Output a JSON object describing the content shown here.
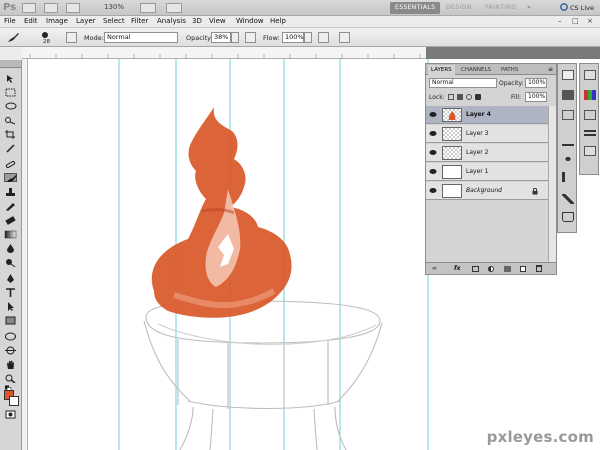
{
  "app": {
    "logo": "Ps",
    "zoom": "130%",
    "workspaces": [
      "ESSENTIALS",
      "DESIGN",
      "PAINTING"
    ],
    "workspace_more": "»",
    "cslive": "CS Live"
  },
  "menu": [
    "File",
    "Edit",
    "Image",
    "Layer",
    "Select",
    "Filter",
    "Analysis",
    "3D",
    "View",
    "Window",
    "Help"
  ],
  "window_controls": [
    "–",
    "□",
    "×"
  ],
  "options": {
    "brush_size": "28",
    "mode_label": "Mode:",
    "mode_value": "Normal",
    "opacity_label": "Opacity:",
    "opacity_value": "38%",
    "flow_label": "Flow:",
    "flow_value": "100%"
  },
  "layers_panel": {
    "tabs": [
      "LAYERS",
      "CHANNELS",
      "PATHS"
    ],
    "blend_mode": "Normal",
    "opacity_label": "Opacity:",
    "opacity_value": "100%",
    "lock_label": "Lock:",
    "fill_label": "Fill:",
    "fill_value": "100%",
    "layers": [
      {
        "name": "Layer 4",
        "selected": true
      },
      {
        "name": "Layer 3",
        "selected": false
      },
      {
        "name": "Layer 2",
        "selected": false
      },
      {
        "name": "Layer 1",
        "selected": false
      },
      {
        "name": "Background",
        "selected": false
      }
    ],
    "footer_icons": [
      "link-icon",
      "fx-icon",
      "mask-icon",
      "adjustment-icon",
      "group-icon",
      "new-layer-icon",
      "trash-icon"
    ]
  },
  "colors": {
    "foreground": "#d95728",
    "background": "#ffffff",
    "guide": "#5fd0d8",
    "paint": "#d95728"
  },
  "watermark": "pxleyes.com"
}
